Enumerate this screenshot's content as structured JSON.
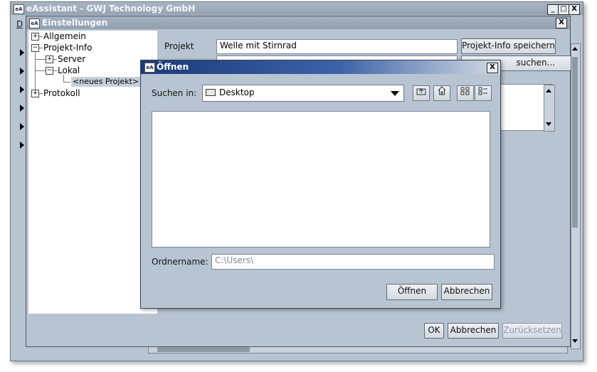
{
  "app": {
    "title": "eAssistant - GWJ Technology GmbH",
    "icon_text": "eA",
    "menu_first": "D",
    "minimize": "_",
    "maximize": "□",
    "close": "X"
  },
  "settings": {
    "title": "Einstellungen",
    "close": "X",
    "tree": {
      "allgemein": "Allgemein",
      "projekt_info": "Projekt-Info",
      "server": "Server",
      "lokal": "Lokal",
      "neues_projekt": "<neues Projekt>",
      "protokoll": "Protokoll"
    },
    "projekt_label": "Projekt",
    "projekt_value": "Welle mit Stirnrad",
    "save_info_button": "Projekt-Info speichern",
    "search_button_partial": "suchen...",
    "ok_button": "OK",
    "cancel_button": "Abbrechen",
    "reset_button": "Zurücksetzen"
  },
  "open_dialog": {
    "title": "Öffnen",
    "close": "X",
    "look_in_label": "Suchen in:",
    "look_in_value": "Desktop",
    "folder_label": "Ordnername:",
    "folder_value": "C:\\Users\\",
    "open_button": "Öffnen",
    "cancel_button": "Abbrechen"
  }
}
